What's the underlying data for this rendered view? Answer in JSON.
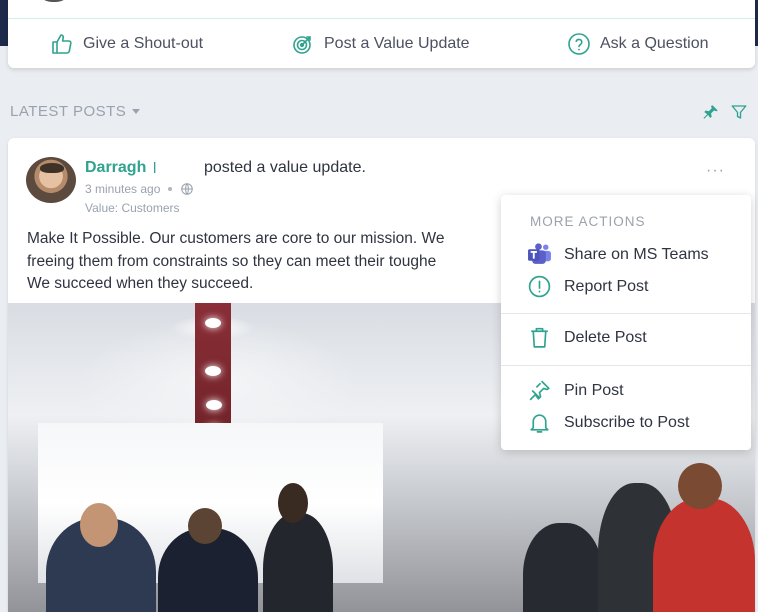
{
  "composer": {
    "actions": [
      {
        "label": "Give a Shout-out",
        "icon": "thumbs-up-icon"
      },
      {
        "label": "Post a Value Update",
        "icon": "target-icon"
      },
      {
        "label": "Ask a Question",
        "icon": "question-circle-icon"
      }
    ]
  },
  "feed": {
    "section_label": "LATEST POSTS"
  },
  "post": {
    "author": "Darragh",
    "author_separator": "l",
    "verb": "posted a value update.",
    "timestamp": "3 minutes ago",
    "value_tag": "Value: Customers",
    "more_label": "···",
    "body_lines": [
      "Make It Possible. Our customers are core to our mission. We",
      "freeing them from constraints so they can meet their toughe",
      "We succeed when they succeed."
    ]
  },
  "menu": {
    "heading": "MORE ACTIONS",
    "items": [
      {
        "label": "Share on MS Teams",
        "icon": "ms-teams-icon"
      },
      {
        "label": "Report Post",
        "icon": "alert-circle-icon"
      },
      {
        "label": "Delete Post",
        "icon": "trash-icon"
      },
      {
        "label": "Pin Post",
        "icon": "pin-icon"
      },
      {
        "label": "Subscribe to Post",
        "icon": "bell-icon"
      }
    ]
  },
  "colors": {
    "accent": "#2fa38f",
    "teams": "#5b5fc7",
    "top_band": "#1e2a4a"
  }
}
